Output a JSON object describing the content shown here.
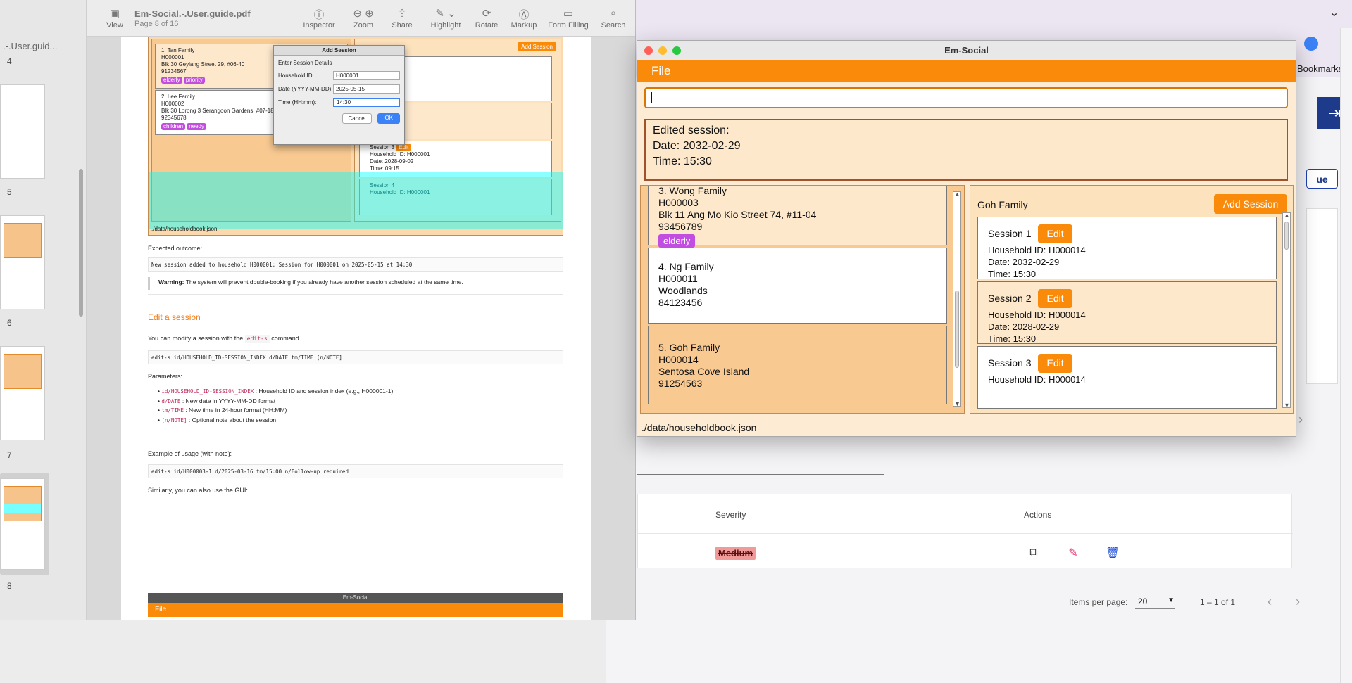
{
  "browser": {
    "bookmarks_label": "Bookmarks",
    "button_fragment": "ue",
    "table": {
      "columns": [
        "Severity",
        "Actions"
      ],
      "rows": [
        {
          "severity": "Medium"
        }
      ]
    },
    "pager": {
      "label": "Items per page:",
      "value": "20",
      "range": "1 – 1 of 1"
    }
  },
  "pdf": {
    "file_title": "Em-Social.-.User.guide.pdf",
    "page_indicator": "Page 8 of 16",
    "sidebar_title": ".-.User.guid...",
    "toolbar": [
      {
        "label": "View",
        "icon": "sidebar-icon"
      },
      {
        "label": "Inspector",
        "icon": "info-icon"
      },
      {
        "label": "Zoom",
        "icon": "zoom-icon"
      },
      {
        "label": "Share",
        "icon": "share-icon"
      },
      {
        "label": "Highlight",
        "icon": "highlight-icon"
      },
      {
        "label": "Rotate",
        "icon": "rotate-icon"
      },
      {
        "label": "Markup",
        "icon": "markup-icon"
      },
      {
        "label": "Form Filling",
        "icon": "form-icon"
      },
      {
        "label": "Search",
        "icon": "search-icon"
      }
    ],
    "thumbnails": [
      "4",
      "5",
      "6",
      "7",
      "8"
    ],
    "content": {
      "dialog_title": "Add Session",
      "dialog_subtitle": "Enter Session Details",
      "dialog_fields": [
        {
          "label": "Household ID:",
          "value": "H000001"
        },
        {
          "label": "Date (YYYY-MM-DD):",
          "value": "2025-05-15"
        },
        {
          "label": "Time (HH:mm):",
          "value": "14:30"
        }
      ],
      "dialog_cancel": "Cancel",
      "dialog_ok": "OK",
      "shot_add_session": "Add Session",
      "shot_h1": [
        "1.  Tan Family",
        "H000001",
        "Blk 30 Geylang Street 29, #06-40",
        "91234567"
      ],
      "shot_h1_tags": [
        "elderly",
        "priority"
      ],
      "shot_h2": [
        "2.  Lee Family",
        "H000002",
        "Blk 30 Lorong 3 Serangoon Gardens, #07-18",
        "92345678"
      ],
      "shot_h2_tags": [
        "children",
        "needy"
      ],
      "shot_session3": "Session 3",
      "shot_edit": "Edit",
      "shot_session3_lines": [
        "Household ID: H000001",
        "Date: 2028-09-02",
        "Time: 09:15"
      ],
      "shot_session4": "Session 4",
      "shot_session4_line": "Household ID: H000001",
      "shot_status": "./data/householdbook.json",
      "expected_label": "Expected outcome:",
      "expected_code": "New session added to household H000001: Session for H000001 on 2025-05-15 at 14:30",
      "warning_bold": "Warning:",
      "warning_text": "The system will prevent double-booking if you already have another session scheduled at the same time.",
      "heading": "Edit a session",
      "intro_pre": "You can modify a session with the",
      "intro_code": "edit-s",
      "intro_post": "command.",
      "syntax": "edit-s id/HOUSEHOLD_ID-SESSION_INDEX d/DATE tm/TIME [n/NOTE]",
      "params_label": "Parameters:",
      "params": [
        {
          "code": "id/HOUSEHOLD_ID-SESSION_INDEX",
          "text": ": Household ID and session index (e.g., H000001-1)"
        },
        {
          "code": "d/DATE",
          "text": ": New date in YYYY-MM-DD format"
        },
        {
          "code": "tm/TIME",
          "text": ": New time in 24-hour format (HH:MM)"
        },
        {
          "code": "[n/NOTE]",
          "text": ": Optional note about the session"
        }
      ],
      "example_label": "Example of usage (with note):",
      "example_code": "edit-s id/H000003-1 d/2025-03-16 tm/15:00 n/Follow-up required",
      "gui_label": "Similarly, you can also use the GUI:",
      "next_app_title": "Em-Social",
      "next_menu": "File"
    }
  },
  "app": {
    "title": "Em-Social",
    "menu_file": "File",
    "command_value": "",
    "result_lines": [
      "Edited session:",
      "Date: 2032-02-29",
      "Time: 15:30"
    ],
    "households": [
      {
        "name": "3.  Wong Family",
        "id": "H000003",
        "address": "Blk 11 Ang Mo Kio Street 74, #11-04",
        "phone": "93456789",
        "tags": [
          "elderly"
        ]
      },
      {
        "name": "4.  Ng Family",
        "id": "H000011",
        "address": "Woodlands",
        "phone": "84123456",
        "tags": []
      },
      {
        "name": "5.  Goh Family",
        "id": "H000014",
        "address": "Sentosa Cove Island",
        "phone": "91254563",
        "tags": []
      }
    ],
    "selected_household": "Goh Family",
    "add_session_label": "Add Session",
    "edit_label": "Edit",
    "sessions": [
      {
        "title": "Session 1",
        "household": "Household ID: H000014",
        "date": "Date: 2032-02-29",
        "time": "Time: 15:30"
      },
      {
        "title": "Session 2",
        "household": "Household ID: H000014",
        "date": "Date: 2028-02-29",
        "time": "Time: 15:30"
      },
      {
        "title": "Session 3",
        "household": "Household ID: H000014",
        "date": "",
        "time": ""
      }
    ],
    "status_path": "./data/householdbook.json"
  }
}
